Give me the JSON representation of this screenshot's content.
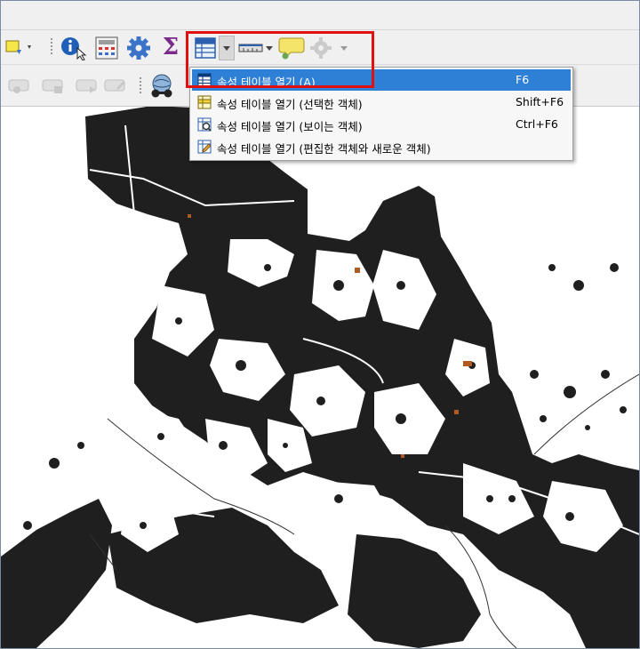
{
  "toolbar": {
    "sigma_glyph": "Σ",
    "icons": [
      "select-feature-icon",
      "identify-icon",
      "field-calculator-icon",
      "processing-gear-icon",
      "statistics-sigma-icon",
      "attribute-table-icon",
      "measure-ruler-icon",
      "map-tips-icon",
      "action-gear-icon"
    ],
    "label_icons": [
      "label-pin-icon",
      "label-show-icon",
      "label-move-icon",
      "label-rotate-icon",
      "label-edit-icon",
      "plugin-globe-icon"
    ]
  },
  "menu": {
    "items": [
      {
        "label": "속성 테이블 열기",
        "paren_open": " (",
        "accel": "A",
        "paren_close": ")",
        "shortcut": "F6",
        "selected": true
      },
      {
        "label": "속성 테이블 열기 (선택한 객체)",
        "shortcut": "Shift+F6",
        "selected": false
      },
      {
        "label": "속성 테이블 열기 (보이는 객체)",
        "shortcut": "Ctrl+F6",
        "selected": false
      },
      {
        "label": "속성 테이블 열기 (편집한 객체와 새로운 객체)",
        "shortcut": "",
        "selected": false
      }
    ]
  },
  "colors": {
    "highlight_border": "#e01010",
    "menu_selected": "#2e7fd6",
    "map_fill": "#1f1f1f",
    "map_accent": "#b05a20",
    "toolbar_bg": "#f0f0f0"
  }
}
